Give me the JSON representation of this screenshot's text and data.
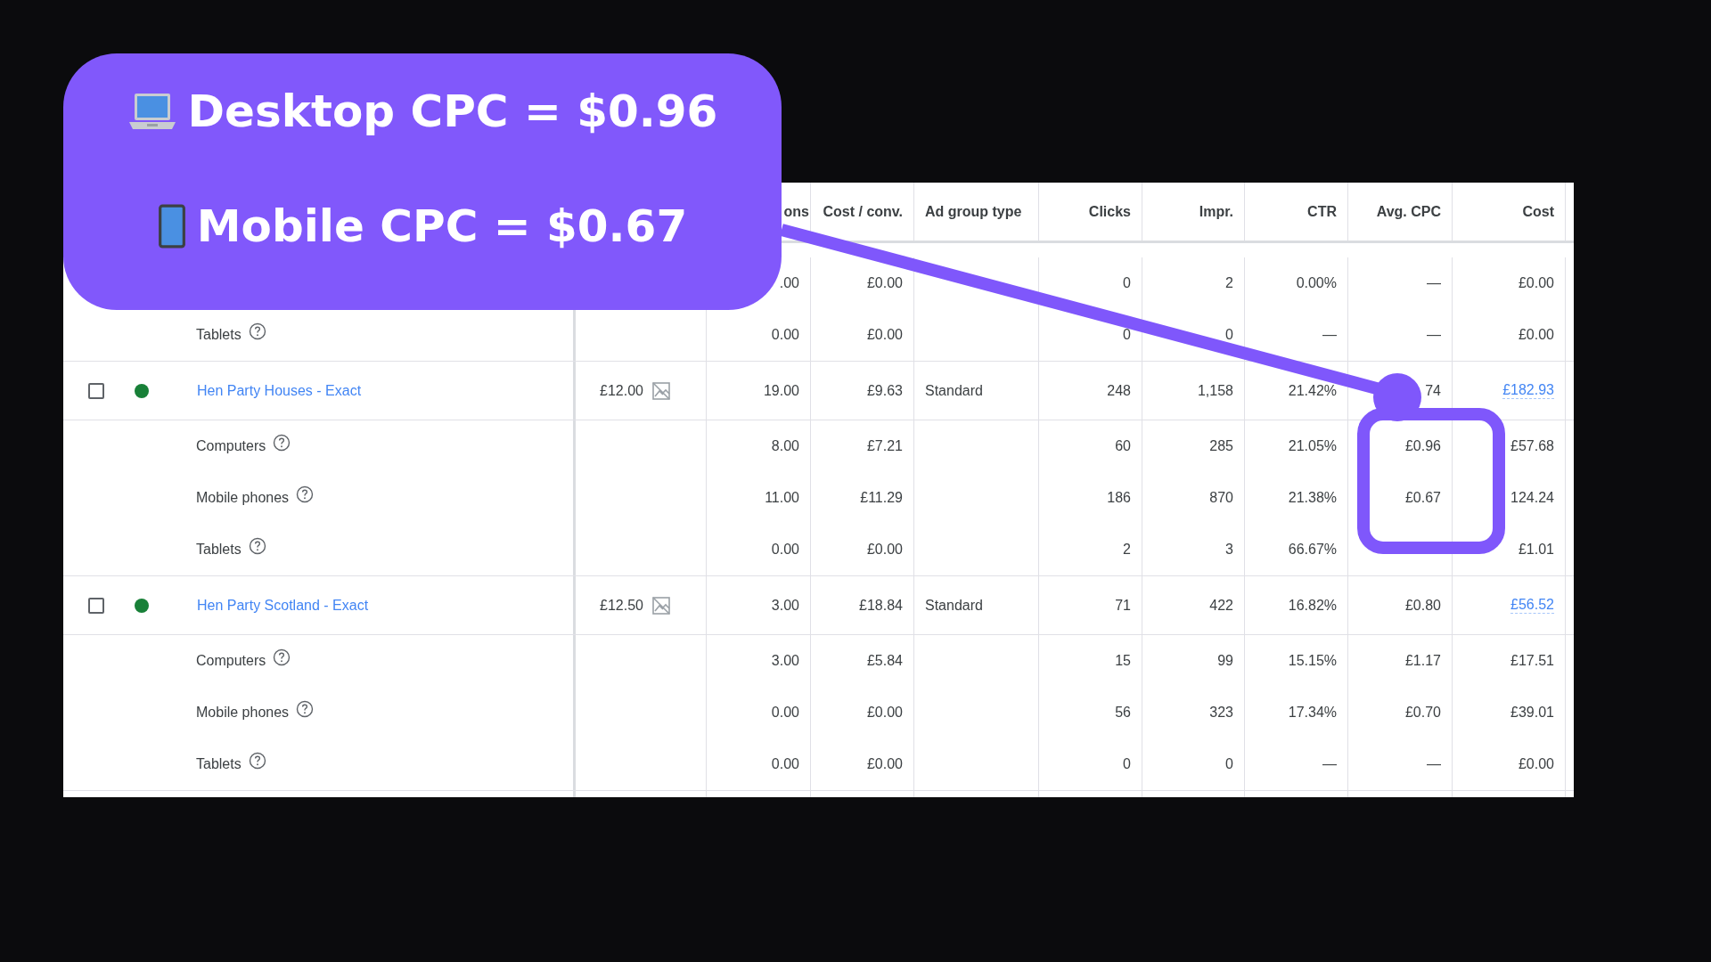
{
  "callout": {
    "lines": [
      {
        "kind": "laptop",
        "text": "Desktop CPC = $0.96"
      },
      {
        "kind": "phone",
        "text": "Mobile CPC = $0.67"
      }
    ]
  },
  "table": {
    "columns": [
      "ons",
      "Cost / conv.",
      "Ad group type",
      "Clicks",
      "Impr.",
      "CTR",
      "Avg. CPC",
      "Cost"
    ],
    "sections": [
      {
        "devices": [
          {
            "conversions": ".00",
            "cost_per_conv": "£0.00",
            "clicks": "0",
            "impr": "2",
            "ctr": "0.00%",
            "avg_cpc": "—",
            "cost": "£0.00"
          },
          {
            "label": "Tablets",
            "conversions": "0.00",
            "cost_per_conv": "£0.00",
            "clicks": "0",
            "impr": "0",
            "ctr": "—",
            "avg_cpc": "—",
            "cost": "£0.00"
          }
        ]
      },
      {
        "group": {
          "checked": false,
          "color": "#188038",
          "name": "Hen Party Houses - Exact",
          "bid": "£12.00",
          "conversions": "19.00",
          "cost_per_conv": "£9.63",
          "ad_group_type": "Standard",
          "clicks": "248",
          "impr": "1,158",
          "ctr": "21.42%",
          "avg_cpc": "74",
          "cost": "£182.93"
        },
        "devices": [
          {
            "label": "Computers",
            "conversions": "8.00",
            "cost_per_conv": "£7.21",
            "clicks": "60",
            "impr": "285",
            "ctr": "21.05%",
            "avg_cpc": "£0.96",
            "cost": "£57.68"
          },
          {
            "label": "Mobile phones",
            "conversions": "11.00",
            "cost_per_conv": "£11.29",
            "clicks": "186",
            "impr": "870",
            "ctr": "21.38%",
            "avg_cpc": "£0.67",
            "cost": "124.24"
          },
          {
            "label": "Tablets",
            "conversions": "0.00",
            "cost_per_conv": "£0.00",
            "clicks": "2",
            "impr": "3",
            "ctr": "66.67%",
            "cost": "£1.01"
          }
        ]
      },
      {
        "group": {
          "checked": false,
          "color": "#188038",
          "name": "Hen Party Scotland - Exact",
          "bid": "£12.50",
          "conversions": "3.00",
          "cost_per_conv": "£18.84",
          "ad_group_type": "Standard",
          "clicks": "71",
          "impr": "422",
          "ctr": "16.82%",
          "avg_cpc": "£0.80",
          "cost": "£56.52"
        },
        "devices": [
          {
            "label": "Computers",
            "conversions": "3.00",
            "cost_per_conv": "£5.84",
            "clicks": "15",
            "impr": "99",
            "ctr": "15.15%",
            "avg_cpc": "£1.17",
            "cost": "£17.51"
          },
          {
            "label": "Mobile phones",
            "conversions": "0.00",
            "cost_per_conv": "£0.00",
            "clicks": "56",
            "impr": "323",
            "ctr": "17.34%",
            "avg_cpc": "£0.70",
            "cost": "£39.01"
          },
          {
            "label": "Tablets",
            "conversions": "0.00",
            "cost_per_conv": "£0.00",
            "clicks": "0",
            "impr": "0",
            "ctr": "—",
            "avg_cpc": "—",
            "cost": "£0.00"
          }
        ]
      }
    ]
  }
}
